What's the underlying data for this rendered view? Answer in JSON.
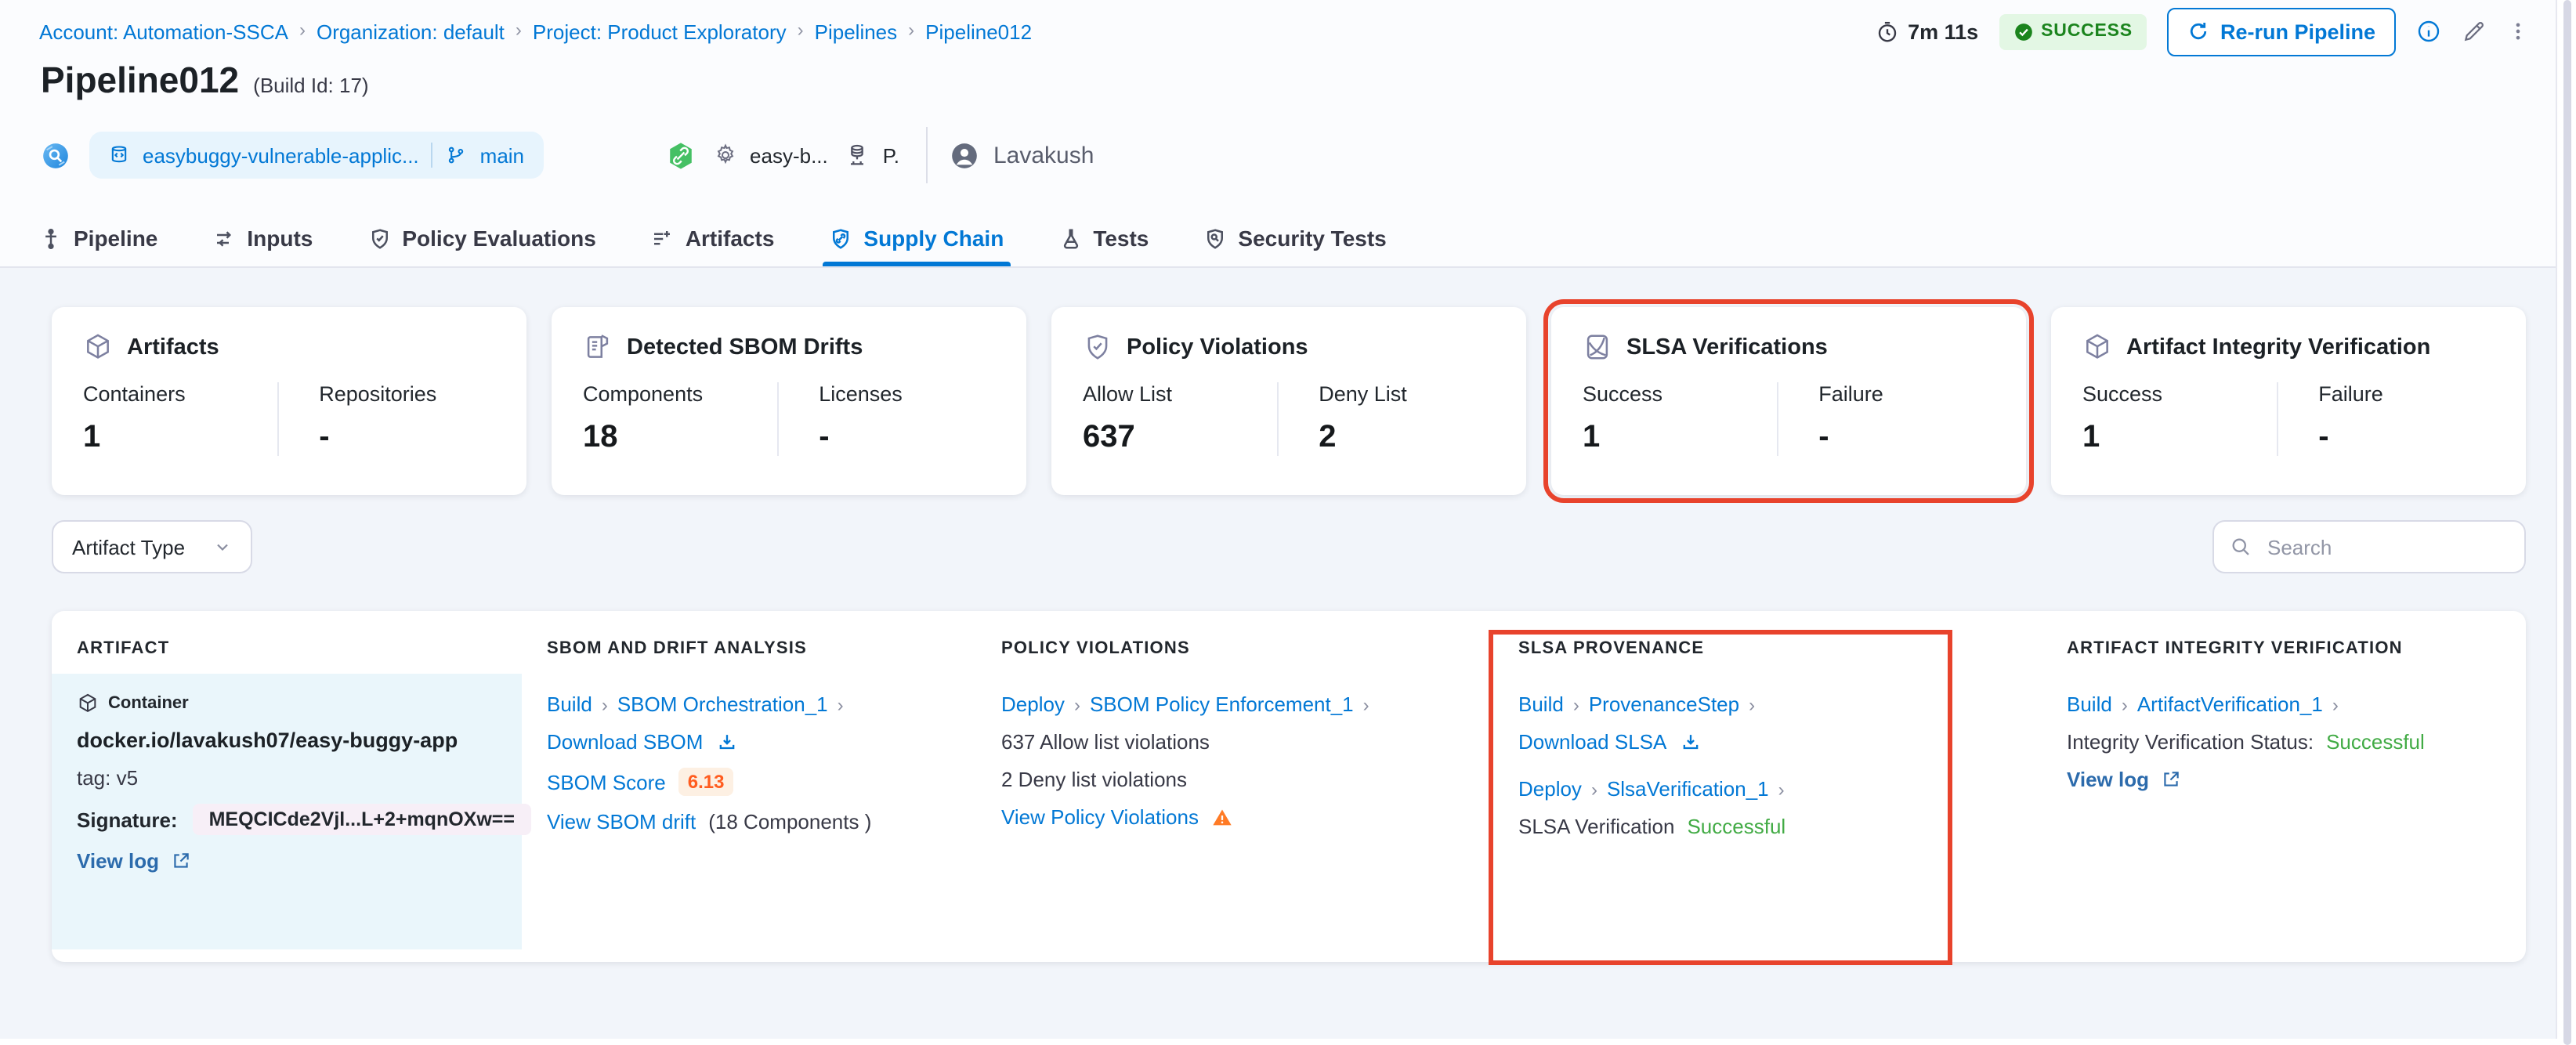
{
  "breadcrumb": {
    "items": [
      "Account: Automation-SSCA",
      "Organization: default",
      "Project: Product Exploratory",
      "Pipelines",
      "Pipeline012"
    ]
  },
  "topbar": {
    "duration": "7m 11s",
    "status": "SUCCESS",
    "rerun_label": "Re-run Pipeline"
  },
  "header": {
    "title": "Pipeline012",
    "build_id": "(Build Id: 17)",
    "repo": "easybuggy-vulnerable-applic...",
    "branch": "main",
    "trigger_pipeline": "easy-b...",
    "trigger_project": "P.",
    "user": "Lavakush"
  },
  "tabs": {
    "items": [
      {
        "label": "Pipeline"
      },
      {
        "label": "Inputs"
      },
      {
        "label": "Policy Evaluations"
      },
      {
        "label": "Artifacts"
      },
      {
        "label": "Supply Chain"
      },
      {
        "label": "Tests"
      },
      {
        "label": "Security Tests"
      }
    ],
    "active": "Supply Chain"
  },
  "cards": [
    {
      "title": "Artifacts",
      "stats": [
        {
          "label": "Containers",
          "value": "1"
        },
        {
          "label": "Repositories",
          "value": "-"
        }
      ]
    },
    {
      "title": "Detected SBOM Drifts",
      "stats": [
        {
          "label": "Components",
          "value": "18"
        },
        {
          "label": "Licenses",
          "value": "-"
        }
      ]
    },
    {
      "title": "Policy Violations",
      "stats": [
        {
          "label": "Allow List",
          "value": "637"
        },
        {
          "label": "Deny List",
          "value": "2"
        }
      ]
    },
    {
      "title": "SLSA Verifications",
      "highlighted": true,
      "stats": [
        {
          "label": "Success",
          "value": "1"
        },
        {
          "label": "Failure",
          "value": "-"
        }
      ]
    },
    {
      "title": "Artifact Integrity Verification",
      "stats": [
        {
          "label": "Success",
          "value": "1"
        },
        {
          "label": "Failure",
          "value": "-"
        }
      ]
    }
  ],
  "filters": {
    "artifact_type": "Artifact Type",
    "search_placeholder": "Search"
  },
  "table": {
    "columns": [
      "ARTIFACT",
      "SBOM AND DRIFT ANALYSIS",
      "POLICY VIOLATIONS",
      "SLSA PROVENANCE",
      "ARTIFACT INTEGRITY VERIFICATION"
    ],
    "row": {
      "artifact": {
        "type": "Container",
        "name": "docker.io/lavakush07/easy-buggy-app",
        "tag": "tag: v5",
        "signature_label": "Signature:",
        "signature_value": "MEQCICde2Vjl...L+2+mqnOXw==",
        "view_log": "View log"
      },
      "sbom": {
        "stage": "Build",
        "step": "SBOM Orchestration_1",
        "download": "Download SBOM",
        "score_label": "SBOM Score",
        "score": "6.13",
        "drift_link": "View SBOM drift",
        "drift_info": "(18 Components )"
      },
      "policy": {
        "stage": "Deploy",
        "step": "SBOM Policy Enforcement_1",
        "allow": "637 Allow list violations",
        "deny": "2 Deny list violations",
        "view": "View Policy Violations"
      },
      "slsa": {
        "stage1": "Build",
        "step1": "ProvenanceStep",
        "download": "Download SLSA",
        "stage2": "Deploy",
        "step2": "SlsaVerification_1",
        "status_label": "SLSA Verification",
        "status_value": "Successful"
      },
      "integrity": {
        "stage": "Build",
        "step": "ArtifactVerification_1",
        "status_label": "Integrity Verification Status:",
        "status_value": "Successful",
        "view_log": "View log"
      }
    }
  },
  "colors": {
    "accent_blue": "#0278d5",
    "success_badge_green": "#1b841d",
    "status_text_green": "#42ab45",
    "highlight_red": "#e8432c",
    "warning_orange": "#ff7b26",
    "score_orange": "#ff5c1f",
    "artifact_cell_bg": "#eaf6fb"
  }
}
